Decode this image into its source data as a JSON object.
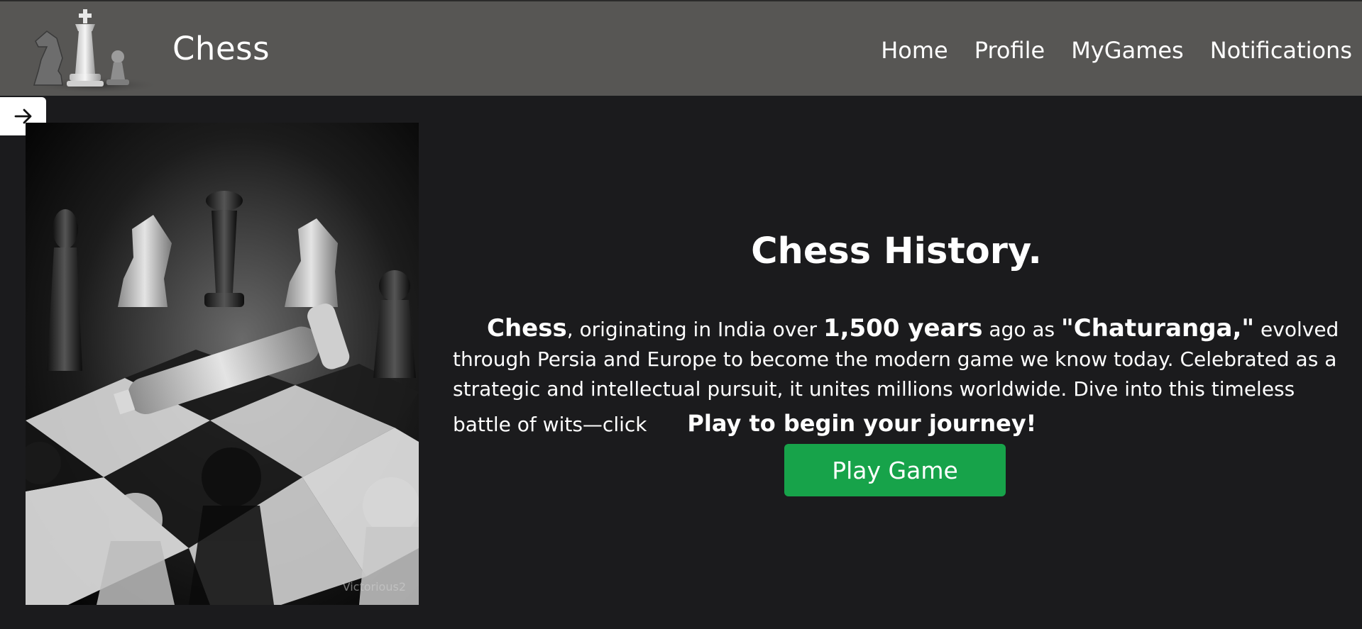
{
  "header": {
    "brand": "Chess",
    "logo_icon": "chess-pieces-logo",
    "nav": [
      {
        "label": "Home"
      },
      {
        "label": "Profile"
      },
      {
        "label": "MyGames"
      },
      {
        "label": "Notifications"
      }
    ]
  },
  "sidebar_toggle": {
    "icon": "arrow-right-icon"
  },
  "hero_image": {
    "watermark": "Victorious2"
  },
  "main": {
    "title": "Chess History.",
    "intro": {
      "chess": "Chess",
      "t1": ", originating in India over ",
      "years": "1,500 years",
      "t2": " ago as ",
      "name": "\"Chaturanga,\"",
      "t3": " evolved through Persia and Europe to become the modern game we know today. Celebrated as a strategic and intellectual pursuit, it unites millions worldwide. Dive into this timeless battle of wits—click ",
      "cta_text": "Play to begin your journey!"
    },
    "play_button": "Play Game"
  },
  "colors": {
    "background": "#1b1b1d",
    "header": "#575654",
    "accent": "#17a34a"
  }
}
